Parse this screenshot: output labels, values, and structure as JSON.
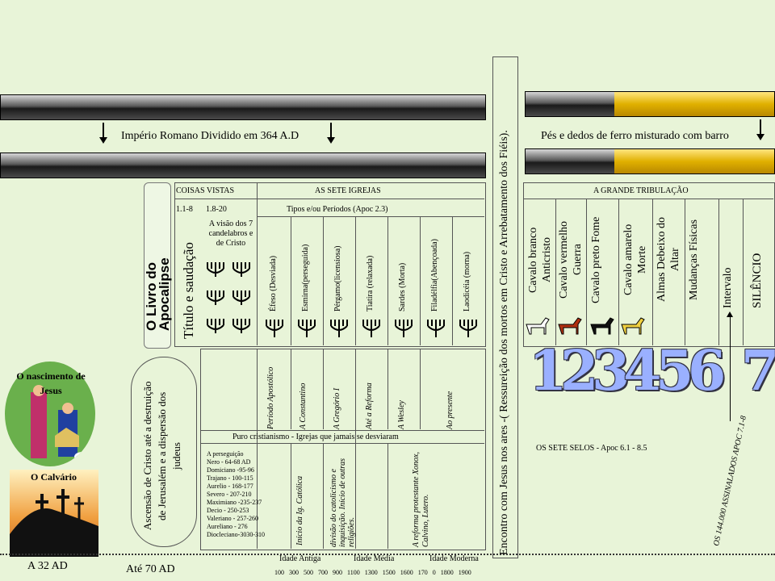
{
  "roman_empire_label": "Império Romano Dividido em 364 A.D",
  "iron_clay_label": "Pés e dedos de ferro misturado com barro",
  "resurrection_text": "Encontro com Jesus nos ares -( Ressureição dos mortos em Cristo e Arrebatamento dos Fiéis).",
  "scroll_title": "O Livro do Apocalipse",
  "title_greeting": "Título e saudação",
  "things_seen": "COISAS VISTAS",
  "seven_churches": "AS SETE IGREJAS",
  "ref_1": "1.1-8",
  "ref_2": "1.8-20",
  "types_periods": "Tipos e/ou Períodos (Apoc 2.3)",
  "vision_text": "A visão dos 7 candelabros e de Cristo",
  "churches": [
    "Éfeso (Desviada)",
    "Esmirna(perseguida)",
    "Pérgamo(licensiosa)",
    "Tiatira (relaxada)",
    "Sardes (Morta)",
    "Filadélfia(Abençoada)",
    "Laodicéia (morna)"
  ],
  "periods": [
    "Período Apostólico",
    "A Constantino",
    "A Gregório I",
    "Até a Reforma",
    "A Wesley",
    "Ao presente"
  ],
  "pure_christianity": "Puro cristianismo - Igrejas que jamais se desviaram",
  "persecution_list": [
    "A perseguição",
    "Nero - 64-68 AD",
    "Domiciano -95-96",
    "Trajano - 100-115",
    "Aurelio - 168-177",
    "Severo - 207-210",
    "Maximiano -235-237",
    "Decio - 250-253",
    "Valeriano - 257-260",
    "Aureliano - 276",
    "Diocleciano-3030-310"
  ],
  "catholic_start": "Início da Ig. Católica",
  "catholic_division": "divisão do catolicismo e inquisição. Início de outras religiões.",
  "reformation": "A reforma protestante Xonox, Calvino, Lutero.",
  "ascension_text": "Ascensão de Cristo até a destruição de Jerusalém e a dispersão dos judeus",
  "birth_label": "O nascimento de Jesus",
  "calvary_label": "O Calvário",
  "year_32": "A 32 AD",
  "year_70": "Até 70 AD",
  "ages": [
    "Idade Antiga",
    "Idade Média",
    "Idade Moderna"
  ],
  "timeline_years": "100 300 500 700 900 1100 1300 1500 1600 170 0 1800 1900",
  "tribulation": "A GRANDE TRIBULAÇÃO",
  "seals": [
    "Cavalo branco Anticristo",
    "Cavalo vermelho Guerra",
    "Cavalo preto Fome",
    "Cavalo amarelo Morte",
    "Almas Debeixo do Altar",
    "Mudanças Físicas",
    "Intervalo",
    "SILÊNCIO"
  ],
  "numbers": [
    "1",
    "2",
    "3",
    "4",
    "5",
    "6",
    "7"
  ],
  "seven_seals": "OS SETE SELOS - Apoc 6.1 - 8.5",
  "sealed_144": "OS 144.000 ASSINALADOS APOC 7.1-8",
  "colors": {
    "background": "#e8f4d8",
    "gold": "#e0b000",
    "number": "#9ab0ff"
  }
}
